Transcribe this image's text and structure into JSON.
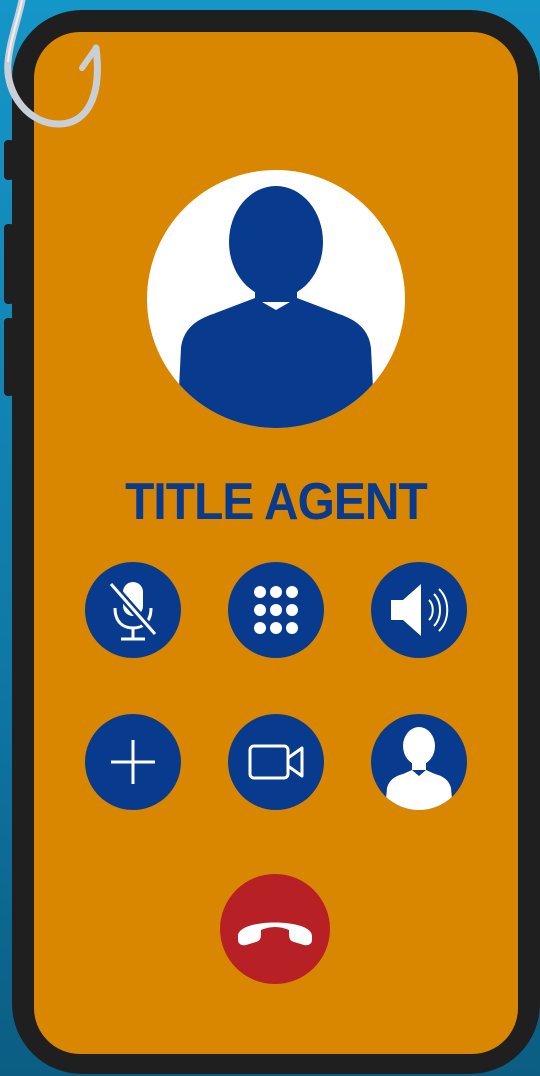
{
  "caller": {
    "name": "TITLE AGENT"
  },
  "controls": [
    {
      "id": "mute",
      "icon": "muted-microphone-icon"
    },
    {
      "id": "keypad",
      "icon": "keypad-icon"
    },
    {
      "id": "speaker",
      "icon": "speaker-icon"
    },
    {
      "id": "add_call",
      "icon": "plus-icon"
    },
    {
      "id": "video",
      "icon": "video-camera-icon"
    },
    {
      "id": "contacts",
      "icon": "person-icon"
    }
  ],
  "end_call": {
    "icon": "phone-hangup-icon"
  },
  "colors": {
    "background": "#1596c8",
    "screen": "#d98600",
    "accent": "#083a8e",
    "end_call": "#b72025",
    "phone_frame": "#1f1f1f"
  }
}
